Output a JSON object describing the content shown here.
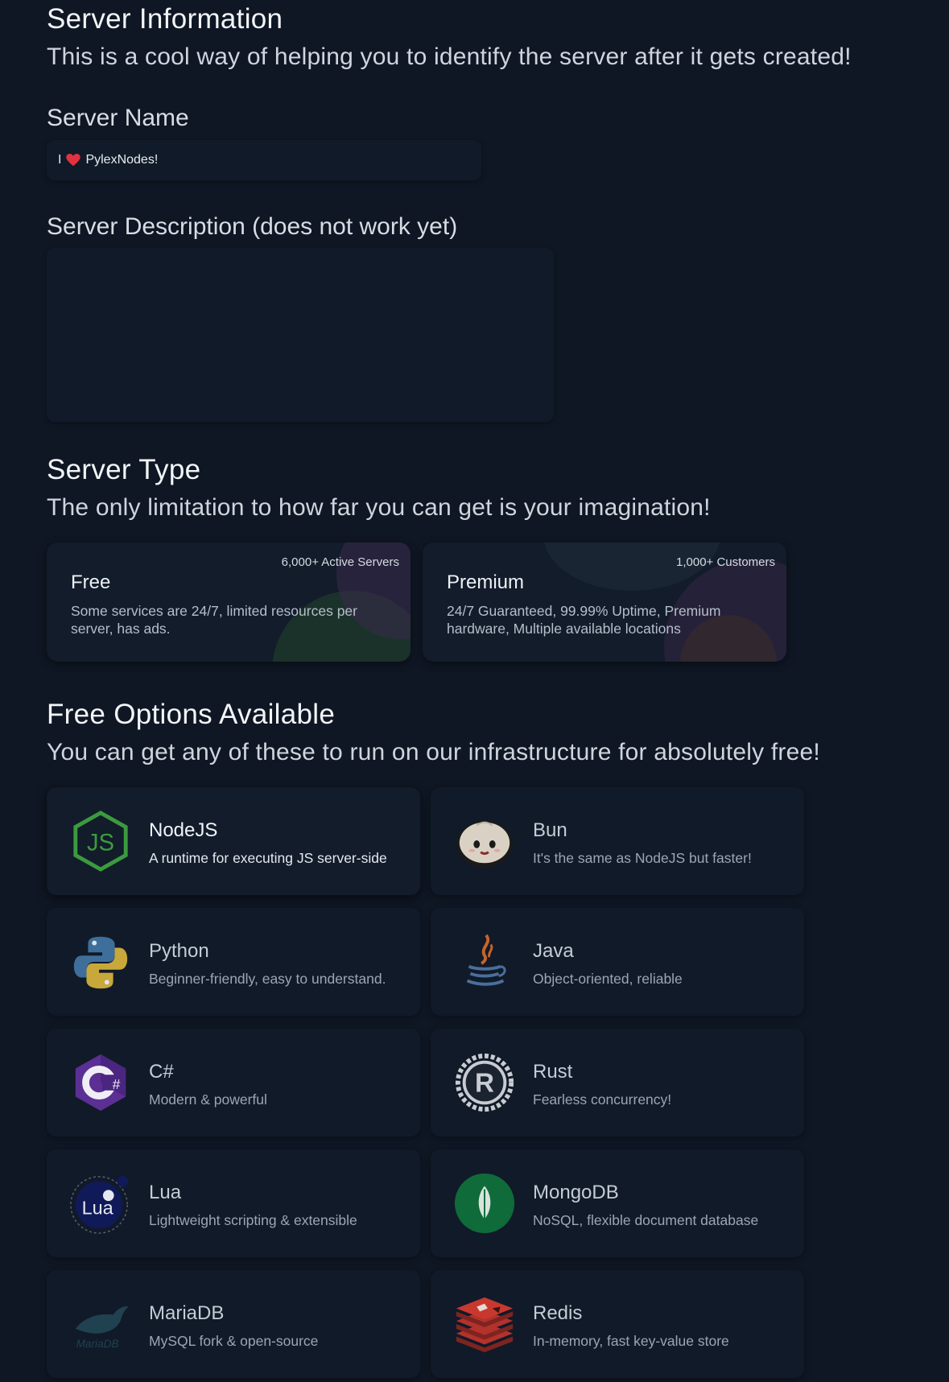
{
  "server_info": {
    "title": "Server Information",
    "subtitle": "This is a cool way of helping you to identify the server after it gets created!",
    "name_label": "Server Name",
    "name_value_prefix": "I",
    "name_value_suffix": "PylexNodes!",
    "description_label": "Server Description (does not work yet)",
    "description_value": ""
  },
  "server_type": {
    "title": "Server Type",
    "subtitle": "The only limitation to how far you can get is your imagination!",
    "cards": [
      {
        "name": "Free",
        "badge": "6,000+ Active Servers",
        "description": "Some services are 24/7, limited resources per server, has ads."
      },
      {
        "name": "Premium",
        "badge": "1,000+ Customers",
        "description": "24/7 Guaranteed, 99.99% Uptime, Premium hardware, Multiple available locations"
      }
    ]
  },
  "free_options": {
    "title": "Free Options Available",
    "subtitle": "You can get any of these to run on our infrastructure for absolutely free!",
    "items": [
      {
        "name": "NodeJS",
        "description": "A runtime for executing JS server-side",
        "icon": "nodejs-icon",
        "selected": true
      },
      {
        "name": "Bun",
        "description": "It's the same as NodeJS but faster!",
        "icon": "bun-icon"
      },
      {
        "name": "Python",
        "description": "Beginner-friendly, easy to understand.",
        "icon": "python-icon"
      },
      {
        "name": "Java",
        "description": "Object-oriented, reliable",
        "icon": "java-icon"
      },
      {
        "name": "C#",
        "description": "Modern & powerful",
        "icon": "csharp-icon"
      },
      {
        "name": "Rust",
        "description": "Fearless concurrency!",
        "icon": "rust-icon"
      },
      {
        "name": "Lua",
        "description": "Lightweight scripting & extensible",
        "icon": "lua-icon"
      },
      {
        "name": "MongoDB",
        "description": "NoSQL, flexible document database",
        "icon": "mongodb-icon"
      },
      {
        "name": "MariaDB",
        "description": "MySQL fork & open-source",
        "icon": "mariadb-icon"
      },
      {
        "name": "Redis",
        "description": "In-memory, fast key-value store",
        "icon": "redis-icon"
      }
    ]
  },
  "colors": {
    "background": "#0f1724",
    "card": "#121c2b",
    "heart": "#e0323f",
    "node_green": "#3c9a3e"
  }
}
